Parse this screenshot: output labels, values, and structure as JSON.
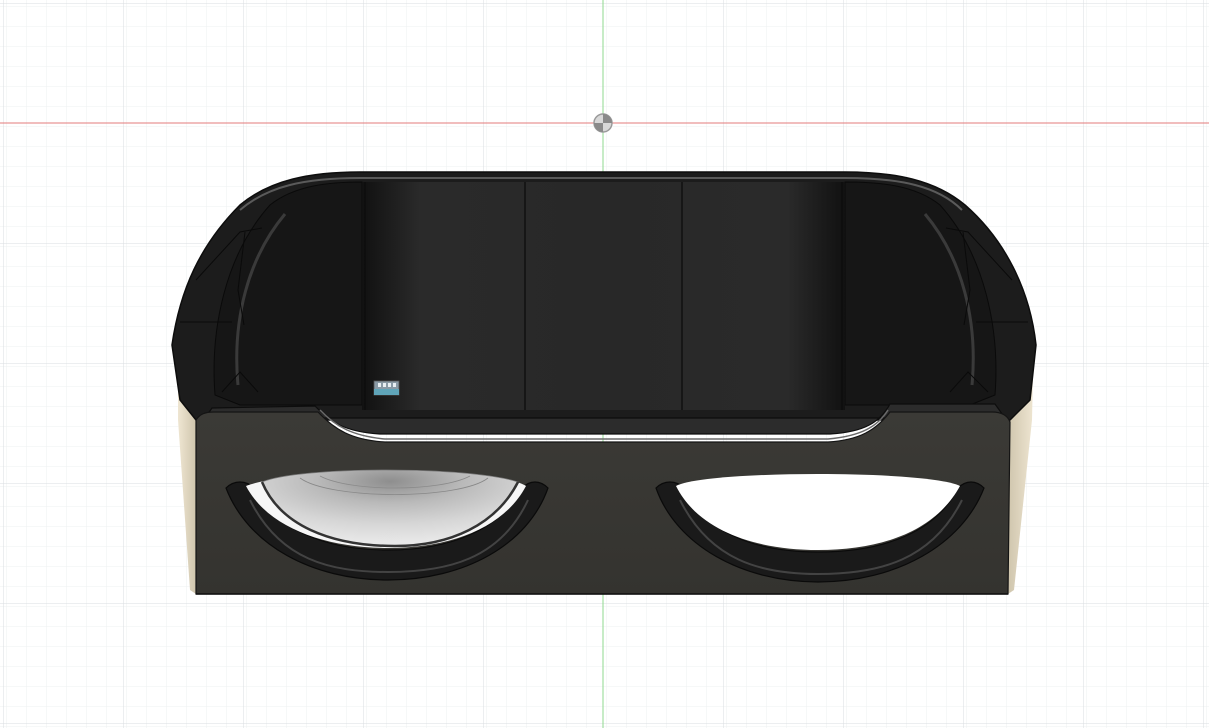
{
  "viewport": {
    "background": "#ffffff",
    "grid": {
      "minor_color": "#eef0f2",
      "major_color": "#dadde0"
    },
    "axes": {
      "x_axis_color": "#e37b7b",
      "y_axis_color": "#8fd88f"
    }
  },
  "model": {
    "body_color": "#2b2b2b",
    "front_color": "#3a3a36",
    "edge_color": "#0d0d0d",
    "side_color": "#e6ddc8"
  },
  "icons": {
    "origin": "origin-marker-icon",
    "marker": "component-marker-icon"
  }
}
